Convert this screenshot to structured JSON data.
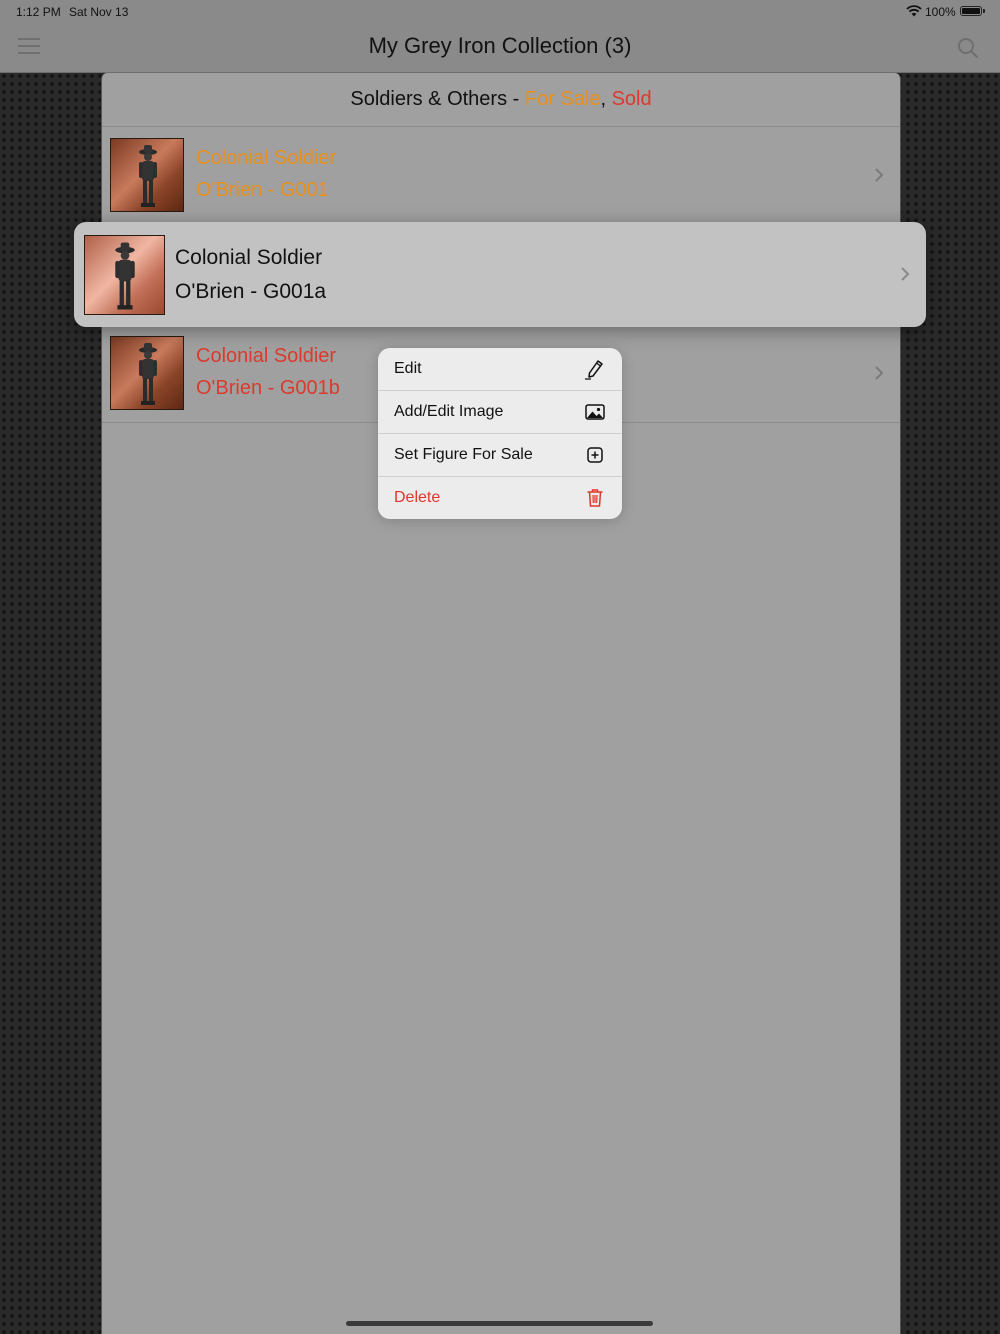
{
  "status_bar": {
    "time": "1:12 PM",
    "date": "Sat Nov 13",
    "battery": "100%"
  },
  "nav": {
    "title": "My Grey Iron Collection (3)"
  },
  "section": {
    "title": "Soldiers & Others - ",
    "for_sale": "For Sale",
    "comma": ",",
    "sold": "Sold"
  },
  "rows": [
    {
      "name": "Colonial Soldier",
      "detail": "O'Brien - G001",
      "status": "for-sale",
      "color": "#e8901a"
    },
    {
      "name": "Colonial Soldier",
      "detail": "O'Brien - G001a",
      "status": "normal",
      "color": "#111111"
    },
    {
      "name": "Colonial Soldier",
      "detail": "O'Brien - G001b",
      "status": "sold",
      "color": "#dc3a2c"
    }
  ],
  "context_menu": [
    {
      "label": "Edit",
      "icon": "pencil-icon"
    },
    {
      "label": "Add/Edit Image",
      "icon": "photo-icon"
    },
    {
      "label": "Set Figure For Sale",
      "icon": "plus-square-icon"
    },
    {
      "label": "Delete",
      "icon": "trash-icon",
      "destructive": true
    }
  ],
  "colors": {
    "for_sale": "#e8901a",
    "sold": "#dc3a2c",
    "destructive": "#e0362a"
  }
}
